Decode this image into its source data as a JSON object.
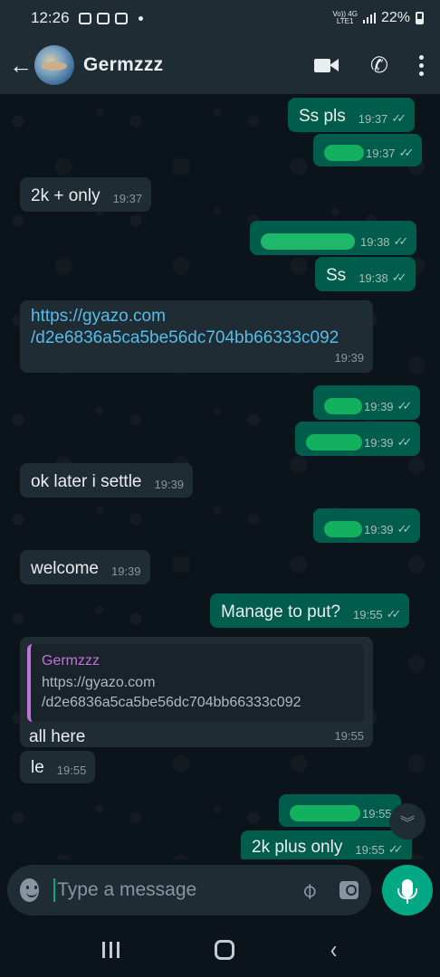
{
  "status_bar": {
    "time": "12:26",
    "network_top": "Vo)) 4G",
    "network_bottom": "LTE1",
    "battery": "22%"
  },
  "header": {
    "back_label": "←",
    "contact_name": "Germzzz"
  },
  "messages": [
    {
      "id": "m1",
      "text": "Ss pls",
      "time": "19:37",
      "dir": "out"
    },
    {
      "id": "m2",
      "text": "",
      "time": "19:37",
      "dir": "out",
      "redacted": true
    },
    {
      "id": "m3",
      "text": "2k + only",
      "time": "19:37",
      "dir": "in"
    },
    {
      "id": "m4",
      "text": "",
      "time": "19:38",
      "dir": "out",
      "redacted": true
    },
    {
      "id": "m5",
      "text": "Ss",
      "time": "19:38",
      "dir": "out"
    },
    {
      "id": "m6",
      "line1": "https://gyazo.com",
      "line2": "/d2e6836a5ca5be56dc704bb66333c092",
      "time": "19:39",
      "dir": "in"
    },
    {
      "id": "m7",
      "text": "",
      "time": "19:39",
      "dir": "out",
      "redacted": true
    },
    {
      "id": "m8",
      "text": "",
      "time": "19:39",
      "dir": "out",
      "redacted": true
    },
    {
      "id": "m9",
      "text": "ok later i settle",
      "time": "19:39",
      "dir": "in"
    },
    {
      "id": "m10",
      "text": "",
      "time": "19:39",
      "dir": "out",
      "redacted": true
    },
    {
      "id": "m11",
      "text": "welcome",
      "time": "19:39",
      "dir": "in"
    },
    {
      "id": "m12",
      "text": "Manage to put?",
      "time": "19:55",
      "dir": "out"
    },
    {
      "id": "m13",
      "quote_name": "Germzzz",
      "quote_line1": "https://gyazo.com",
      "quote_line2": "/d2e6836a5ca5be56dc704bb66333c092",
      "text": "all here",
      "time": "19:55",
      "dir": "in"
    },
    {
      "id": "m14",
      "text": "le",
      "time": "19:55",
      "dir": "in"
    },
    {
      "id": "m15",
      "text": "",
      "time": "19:55",
      "dir": "out",
      "redacted": true
    },
    {
      "id": "m16",
      "text": "2k plus only",
      "time": "19:55",
      "dir": "out"
    }
  ],
  "composer": {
    "placeholder": "Type a message"
  },
  "icons": {
    "back": "arrow-left-icon",
    "video": "video-call-icon",
    "call": "phone-icon",
    "menu": "more-vert-icon",
    "emoji": "emoji-icon",
    "attach": "paperclip-icon",
    "camera": "camera-icon",
    "mic": "mic-icon",
    "scroll": "chevron-double-down-icon"
  },
  "colors": {
    "outgoing_bubble": "#005c4b",
    "incoming_bubble": "#202c33",
    "accent": "#00a884",
    "link": "#53bdeb",
    "quote_name": "#c074d9"
  }
}
